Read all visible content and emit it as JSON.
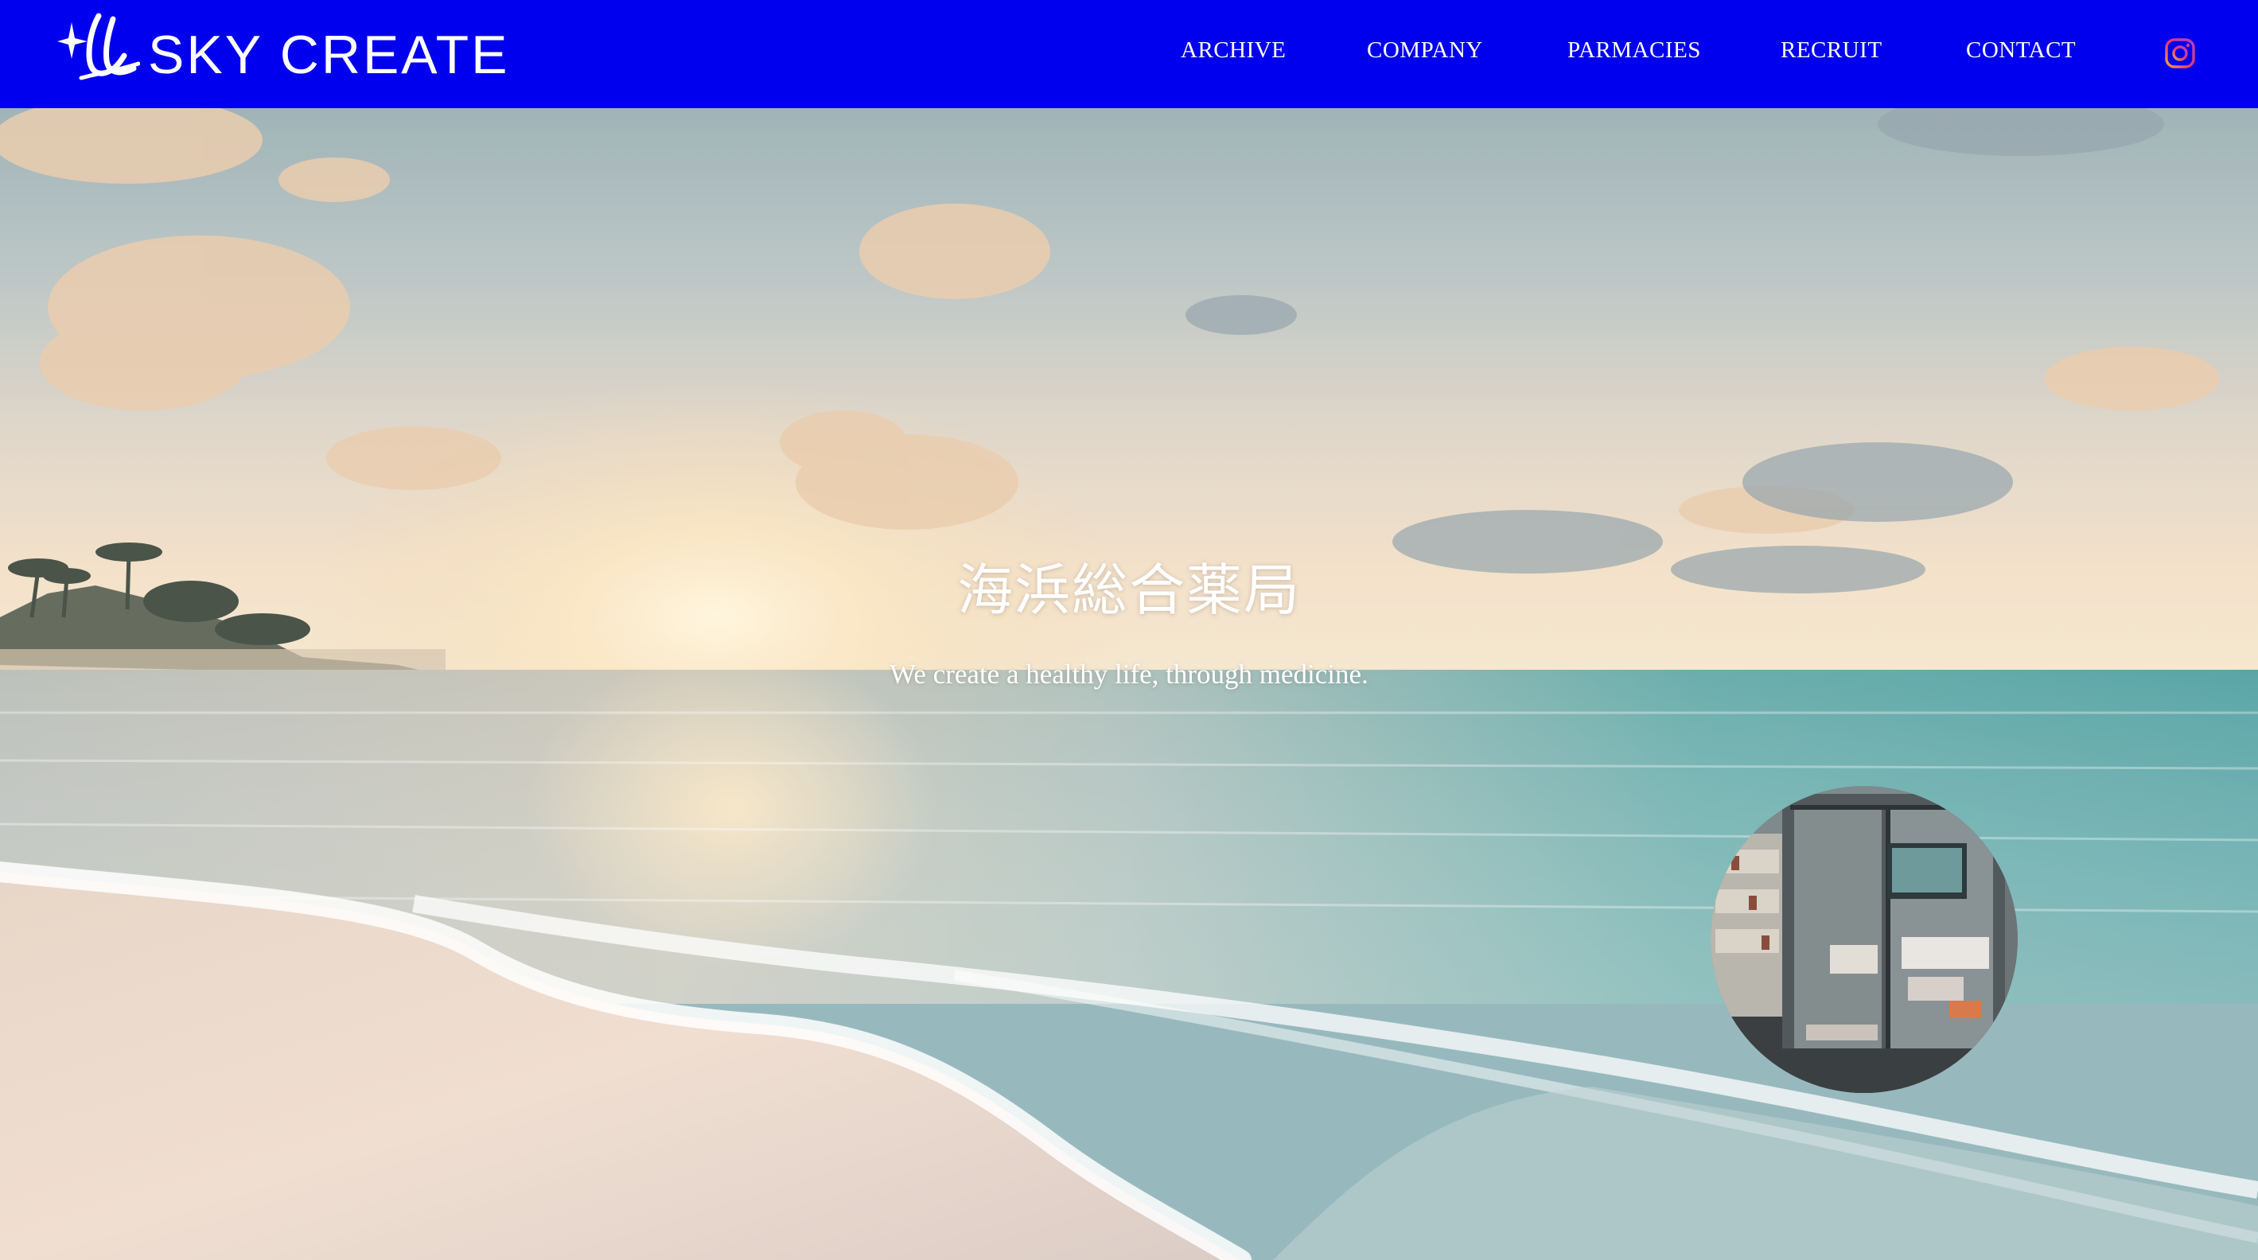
{
  "brand": {
    "name": "SKY CREATE",
    "header_color": "#0000ee"
  },
  "nav": {
    "items": [
      {
        "label": "ARCHIVE"
      },
      {
        "label": "COMPANY"
      },
      {
        "label": "PARMACIES"
      },
      {
        "label": "RECRUIT"
      },
      {
        "label": "CONTACT"
      }
    ],
    "social_icon": "instagram-icon"
  },
  "hero": {
    "title": "海浜総合薬局",
    "subtitle": "We create a healthy life, through medicine.",
    "background": "sunset-beach-photo",
    "featured_image": "pharmacy-interior-photo"
  }
}
